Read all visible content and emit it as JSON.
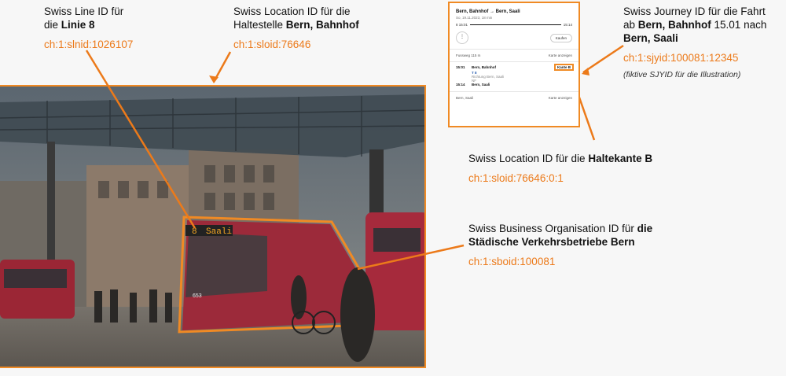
{
  "colors": {
    "accent": "#ec7a1a",
    "frame": "#f08a24"
  },
  "labels": {
    "line": {
      "pre": "Swiss Line ID für",
      "pre2": "die ",
      "bold": "Linie 8",
      "id": "ch:1:slnid:1026107"
    },
    "stop": {
      "pre": "Swiss Location ID für die",
      "pre2": "Haltestelle ",
      "bold": "Bern, Bahnhof",
      "id": "ch:1:sloid:76646"
    },
    "journey": {
      "pre": "Swiss Journey ID für die Fahrt",
      "pre2": "ab ",
      "bold1": "Bern, Bahnhof",
      "mid": " 15.01 nach",
      "bold2": "Bern, Saali",
      "id": "ch:1:sjyid:100081:12345",
      "note": "(fiktive SJYID für die Illustration)"
    },
    "edge": {
      "pre": "Swiss Location ID für die ",
      "bold": "Haltekante B",
      "id": "ch:1:sloid:76646:0:1"
    },
    "org": {
      "pre": "Swiss Business Organisation ID für ",
      "bold1": "die",
      "bold2": "Städische Verkehrsbetriebe Bern",
      "id": "ch:1:sboid:100081"
    }
  },
  "card": {
    "title": "Bern, Bahnhof → Bern, Saali",
    "subtitle": "So, 19.11.2023, 18 min",
    "dep": "15:01",
    "arr": "15:14",
    "walk_marker": "8",
    "menu_glyph": "⋮",
    "buy": "Kaufen",
    "walk": "Fussweg 115 m",
    "map_link": "Karte anzeigen",
    "stop1_time": "15:01",
    "stop1": "Bern, Bahnhof",
    "kante": "Kante B",
    "line": "T 8",
    "direction": "Richtung Bern, Saali",
    "nf": "NF",
    "stop2_time": "15:14",
    "stop2": "Bern, Saali",
    "dest": "Bern, Saali",
    "map_link2": "Karte anzeigen"
  },
  "photo": {
    "tram_dest_num": "8",
    "tram_dest": "Saali",
    "tram_number": "653"
  }
}
